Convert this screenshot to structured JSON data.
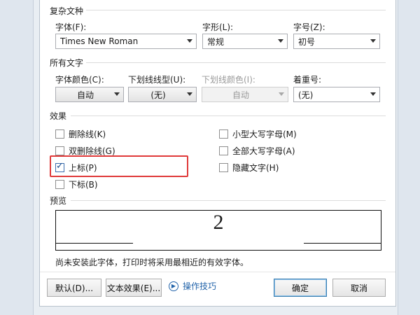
{
  "sections": {
    "complex": "复杂文种",
    "all_text": "所有文字",
    "effects": "效果",
    "preview": "预览"
  },
  "complex": {
    "font_label": "字体(F):",
    "font_value": "Times New Roman",
    "style_label": "字形(L):",
    "style_value": "常规",
    "size_label": "字号(Z):",
    "size_value": "初号"
  },
  "all_text": {
    "color_label": "字体颜色(C):",
    "color_value": "自动",
    "underline_label": "下划线线型(U):",
    "underline_value": "(无)",
    "underline_color_label": "下划线颜色(I):",
    "underline_color_value": "自动",
    "emphasis_label": "着重号:",
    "emphasis_value": "(无)"
  },
  "effects": {
    "strikethrough": {
      "label": "删除线(K)",
      "checked": false
    },
    "double_strikethrough": {
      "label": "双删除线(G)",
      "checked": false
    },
    "superscript": {
      "label": "上标(P)",
      "checked": true
    },
    "subscript": {
      "label": "下标(B)",
      "checked": false
    },
    "small_caps": {
      "label": "小型大写字母(M)",
      "checked": false
    },
    "all_caps": {
      "label": "全部大写字母(A)",
      "checked": false
    },
    "hidden": {
      "label": "隐藏文字(H)",
      "checked": false
    }
  },
  "preview": {
    "sample": "2",
    "note": "尚未安装此字体，打印时将采用最相近的有效字体。"
  },
  "buttons": {
    "default": "默认(D)...",
    "text_effects": "文本效果(E)...",
    "tips": "操作技巧",
    "ok": "确定",
    "cancel": "取消"
  },
  "colors": {
    "highlight": "#e03a3a",
    "link": "#2364aa"
  }
}
